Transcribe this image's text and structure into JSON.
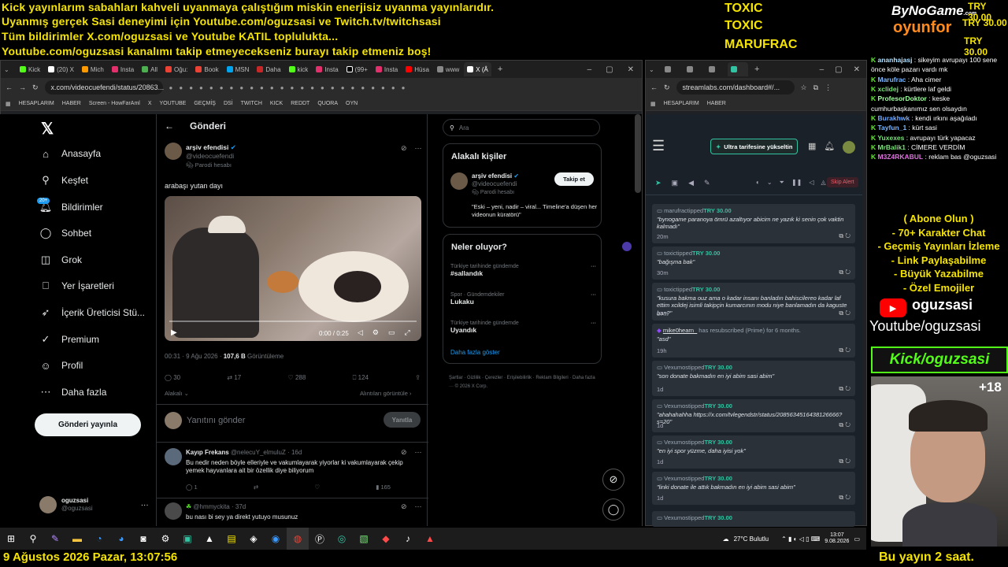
{
  "ticker": {
    "line1": "Kick yayınlarım sabahları kahveli uyanmaya çalıştığım miskin enerjisiz uyanma yayınlarıdır.",
    "line2": "Uyanmış gerçek Sasi deneyimi için Youtube.com/oguzsasi ve Twitch.tv/twitchsasi",
    "line3": "Tüm bildirimler X.com/oguzsasi ve Youtube KATIL toplulukta...",
    "line4": "Youtube.com/oguzsasi kanalımı takip etmeyecekseniz burayı takip etmeniz boş!"
  },
  "donors": [
    "TOXIC",
    "TOXIC",
    "MARUFRAC"
  ],
  "sponsor": {
    "line1": "ByNoGame",
    "line2": "oyunfor",
    "suffix": ".com"
  },
  "tries": [
    "TRY 30.00",
    "TRY 30.00",
    "TRY 30.00"
  ],
  "left_browser": {
    "tabs": [
      "Kick",
      "(20) X",
      "Mich",
      "Insta",
      "All",
      "Oğu:",
      "Book",
      "MSN",
      "Daha",
      "kick",
      "Insta",
      "(99+",
      "Insta",
      "Hüsa",
      "www",
      "X (Â"
    ],
    "url": "x.com/videocuefendi/status/20863...",
    "bookmarks": [
      "HESAPLARIM",
      "HABER",
      "Screen - HowFarAml",
      "X",
      "YOUTUBE",
      "GEÇMİŞ",
      "DSİ",
      "TWITCH",
      "KICK",
      "REDDT",
      "QUORA",
      "OYN"
    ]
  },
  "x_nav": {
    "items": [
      "Anasayfa",
      "Keşfet",
      "Bildirimler",
      "Sohbet",
      "Grok",
      "Yer İşaretleri",
      "İçerik Üreticisi Stü...",
      "Premium",
      "Profil",
      "Daha fazla"
    ],
    "badge": "20+",
    "post_button": "Gönderi yayınla",
    "user_name": "oguzsasi",
    "user_handle": "@oguzsasi"
  },
  "post": {
    "header": "Gönderi",
    "author": "arşiv efendisi",
    "handle": "@videocuefendi",
    "parody": "Parodi hesabı",
    "text": "arabaşı yutan dayı",
    "video_time": "0:00 / 0:25",
    "timestamp": "00:31 · 9 Ağu 2026 ·",
    "views": "107,6 B",
    "views_label": "Görüntüleme",
    "replies": "30",
    "reposts": "17",
    "likes": "288",
    "bookmarks": "124",
    "related": "Alakalı",
    "reposts_label": "Alıntıları görüntüle",
    "reply_placeholder": "Yanıtını gönder",
    "reply_button": "Yanıtla"
  },
  "replies": [
    {
      "name": "Kayıp Frekans",
      "handle": "@nelecuY_elmuluZ · 16d",
      "text": "Bu nedir neden böyle elleriyle ve vakumlayarak yiyorlar ki vakumlayarak çekip yemek hayvanlara ait bir özellik diye biliyorum",
      "replies": "1",
      "likes": "165"
    },
    {
      "name": "",
      "handle": "@hmmyckita · 37d",
      "text": "bu nası bi sey ya direkt yutuyo musunuz"
    }
  ],
  "search_placeholder": "Ara",
  "related_people": {
    "title": "Alakalı kişiler",
    "name": "arşiv efendisi",
    "handle": "@videocuefendi",
    "parody": "Parodi hesabı",
    "bio": "\"Eski – yeni, nadir – viral... Timeline'a düşen her videonun küratörü\"",
    "follow": "Takip et"
  },
  "trends": {
    "title": "Neler oluyor?",
    "items": [
      {
        "meta": "Türkiye tarihinde gündemde",
        "name": "#sallandık"
      },
      {
        "meta": "Spor · Gündemdekiler",
        "name": "Lukaku"
      },
      {
        "meta": "Türkiye tarihinde gündemde",
        "name": "Uyandık"
      }
    ],
    "more": "Daha fazla göster"
  },
  "footer_links": "Şartlar · Gizlilik · Çerezler · Erişilebilirlik · Reklam Bilgileri · Daha fazla ··· © 2026 X Corp.",
  "right_browser": {
    "url": "streamlabs.com/dashboard#/...",
    "bookmarks": [
      "HESAPLARIM",
      "HABER"
    ]
  },
  "streamlabs": {
    "upgrade": "Ultra tarifesine yükseltin",
    "skip": "Skip Alert",
    "items": [
      {
        "name": "marufrac",
        "action": "tipped",
        "amount": "TRY 30.00",
        "msg": "\"bynogame paranoya ömrü azaltıyor abicim ne yazık ki senin çok vaktin kalmadı\"",
        "time": "20m"
      },
      {
        "name": "toxic",
        "action": "tipped",
        "amount": "TRY 30.00",
        "msg": "\"bağışma bak\"",
        "time": "30m"
      },
      {
        "name": "toxic",
        "action": "tipped",
        "amount": "TRY 30.00",
        "msg": "\"kusura bakma ouz ama o kadar insanı banladın bahiscilereo kadar laf ettim xcildej isimli takipçin kumarcının modu niye banlamadın da kaguste ban?\"",
        "time": "37m"
      },
      {
        "name": "mike0hearn_",
        "action": "has resubscribed (Prime) for 6 months.",
        "amount": "",
        "msg": "\"asd\"",
        "time": "19h"
      },
      {
        "name": "Vexumos",
        "action": "tipped",
        "amount": "TRY 30.00",
        "msg": "\"son donate bakmadın en iyi abim sasi abim\"",
        "time": "1d"
      },
      {
        "name": "Vexumos",
        "action": "tipped",
        "amount": "TRY 30.00",
        "msg": "\"ahahahahha https://x.com/tvlegendstr/status/2085634516438126666?s=20\"",
        "time": "1d"
      },
      {
        "name": "Vexumos",
        "action": "tipped",
        "amount": "TRY 30.00",
        "msg": "\"en iyi spor yüzme, daha iyisi yok\"",
        "time": "1d"
      },
      {
        "name": "Vexumos",
        "action": "tipped",
        "amount": "TRY 30.00",
        "msg": "\"linki donate ile attık bakmadın en iyi abim sasi abim\"",
        "time": "1d"
      },
      {
        "name": "Vexumos",
        "action": "tipped",
        "amount": "TRY 30.00",
        "msg": "",
        "time": ""
      }
    ]
  },
  "chat": [
    {
      "user": "ananhajasj",
      "text": ": sikeyim avrupayı 100 sene önce köle pazarı vardı mk",
      "color": "#b0e0ff"
    },
    {
      "user": "Marufrac",
      "text": ": Aha cimer",
      "color": "#7ab7ff"
    },
    {
      "user": "xclidej",
      "text": ": kürtlere laf geldi",
      "color": "#7ae07a"
    },
    {
      "user": "ProfesorDoktor",
      "text": ": keske cumhurbaşkanımız sen olsaydın",
      "color": "#a0ffa0"
    },
    {
      "user": "Burakhwk",
      "text": ": kendi ırkını aşağıladı",
      "color": "#6fa8ff"
    },
    {
      "user": "Tayfun_1",
      "text": ": kürt sasi",
      "color": "#7ab7ff"
    },
    {
      "user": "Yuxexes",
      "text": ": avrupayı türk yapacaz",
      "color": "#7ae07a"
    },
    {
      "user": "MrBalik1",
      "text": ": CİMERE VERDİM",
      "color": "#7ae07a"
    },
    {
      "user": "M3Z4RKABUL",
      "text": ": reklam bas @oguzsasi",
      "color": "#e070e0"
    }
  ],
  "promo": {
    "lines": [
      "( Abone Olun )",
      "- 70+ Karakter Chat",
      "- Geçmiş Yayınları İzleme",
      "- Link Paylaşabilme",
      "- Büyük Yazabilme",
      "- Özel Emojiler"
    ],
    "yt_name": "oguzsasi",
    "yt_url": "Youtube/oguzsasi",
    "kick": "Kick/oguzsasi",
    "cam_badge": "+18"
  },
  "taskbar": {
    "weather": "27°C Bulutlu",
    "time": "13:07",
    "date": "9.08.2026"
  },
  "bottom": {
    "left": "9 Ağustos 2026 Pazar, 13:07:56",
    "right": "Bu yayın 2 saat."
  }
}
